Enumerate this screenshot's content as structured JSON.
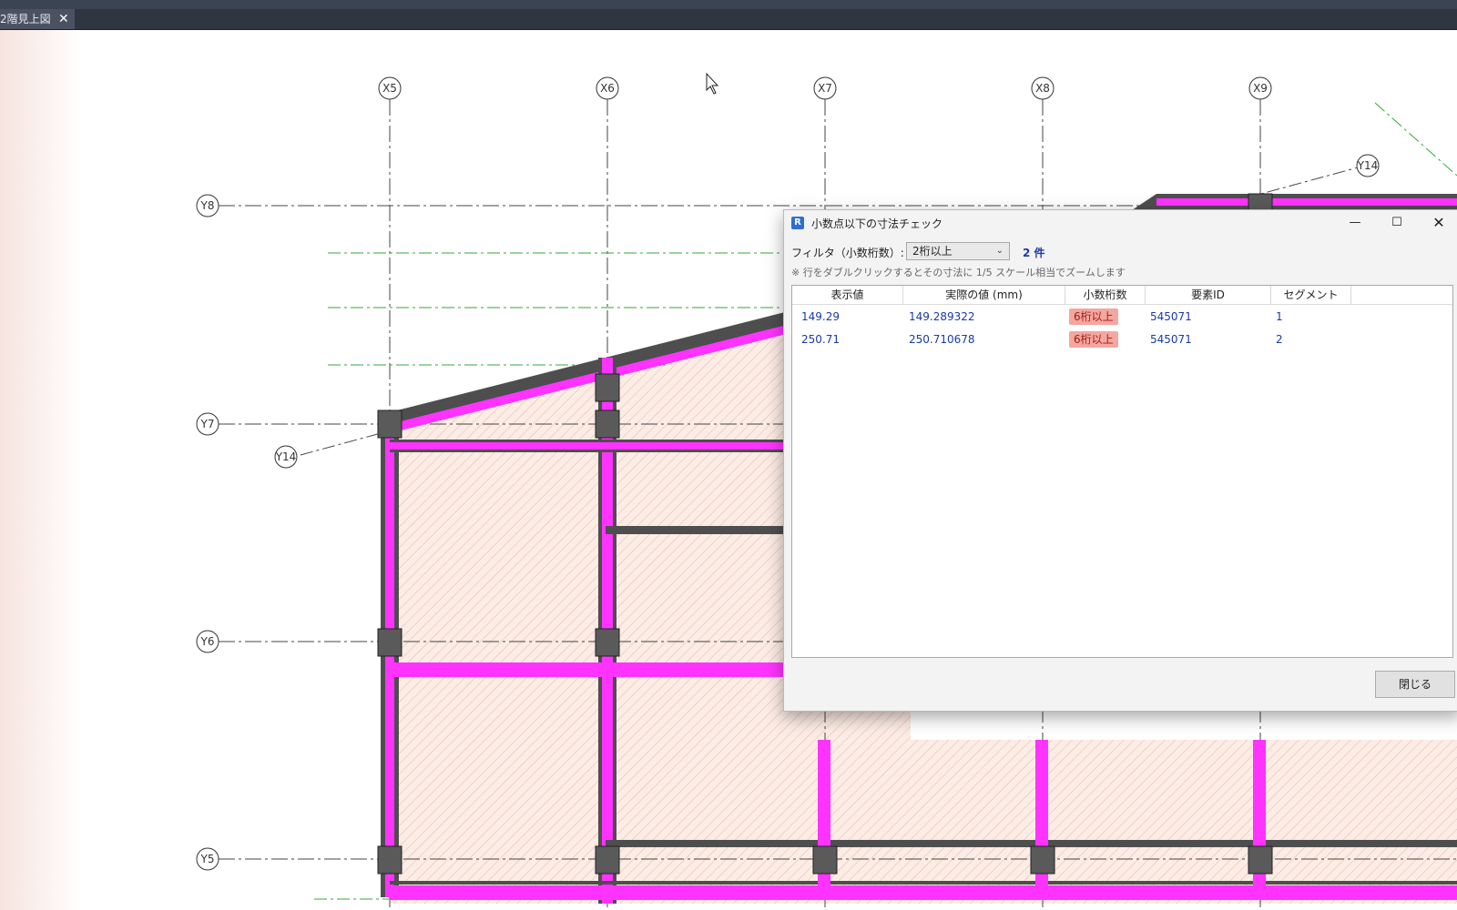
{
  "tab": {
    "title": "2階見上図",
    "close_icon": "close-icon"
  },
  "grid": {
    "x_labels": [
      "X5",
      "X6",
      "X7",
      "X8",
      "X9"
    ],
    "y_labels": [
      "Y8",
      "Y7",
      "Y6",
      "Y5"
    ],
    "slanted_labels": [
      "Y14",
      "Y14"
    ]
  },
  "dialog": {
    "title": "小数点以下の寸法チェック",
    "filter_label": "フィルタ（小数桁数）:",
    "filter_value": "2桁以上",
    "count": "2 件",
    "note": "※ 行をダブルクリックするとその寸法に 1/5 スケール相当でズームします",
    "columns": [
      "表示値",
      "実際の値 (mm)",
      "小数桁数",
      "要素ID",
      "セグメント"
    ],
    "rows": [
      {
        "display": "149.29",
        "actual": "149.289322",
        "digits": "6桁以上",
        "element_id": "545071",
        "segment": "1"
      },
      {
        "display": "250.71",
        "actual": "250.710678",
        "digits": "6桁以上",
        "element_id": "545071",
        "segment": "2"
      }
    ],
    "close_label": "閉じる",
    "colors": {
      "badge": "#f4a6a0",
      "count": "#1a3aa8",
      "wall": "#ff33ff",
      "column": "#5a5a5a"
    }
  }
}
